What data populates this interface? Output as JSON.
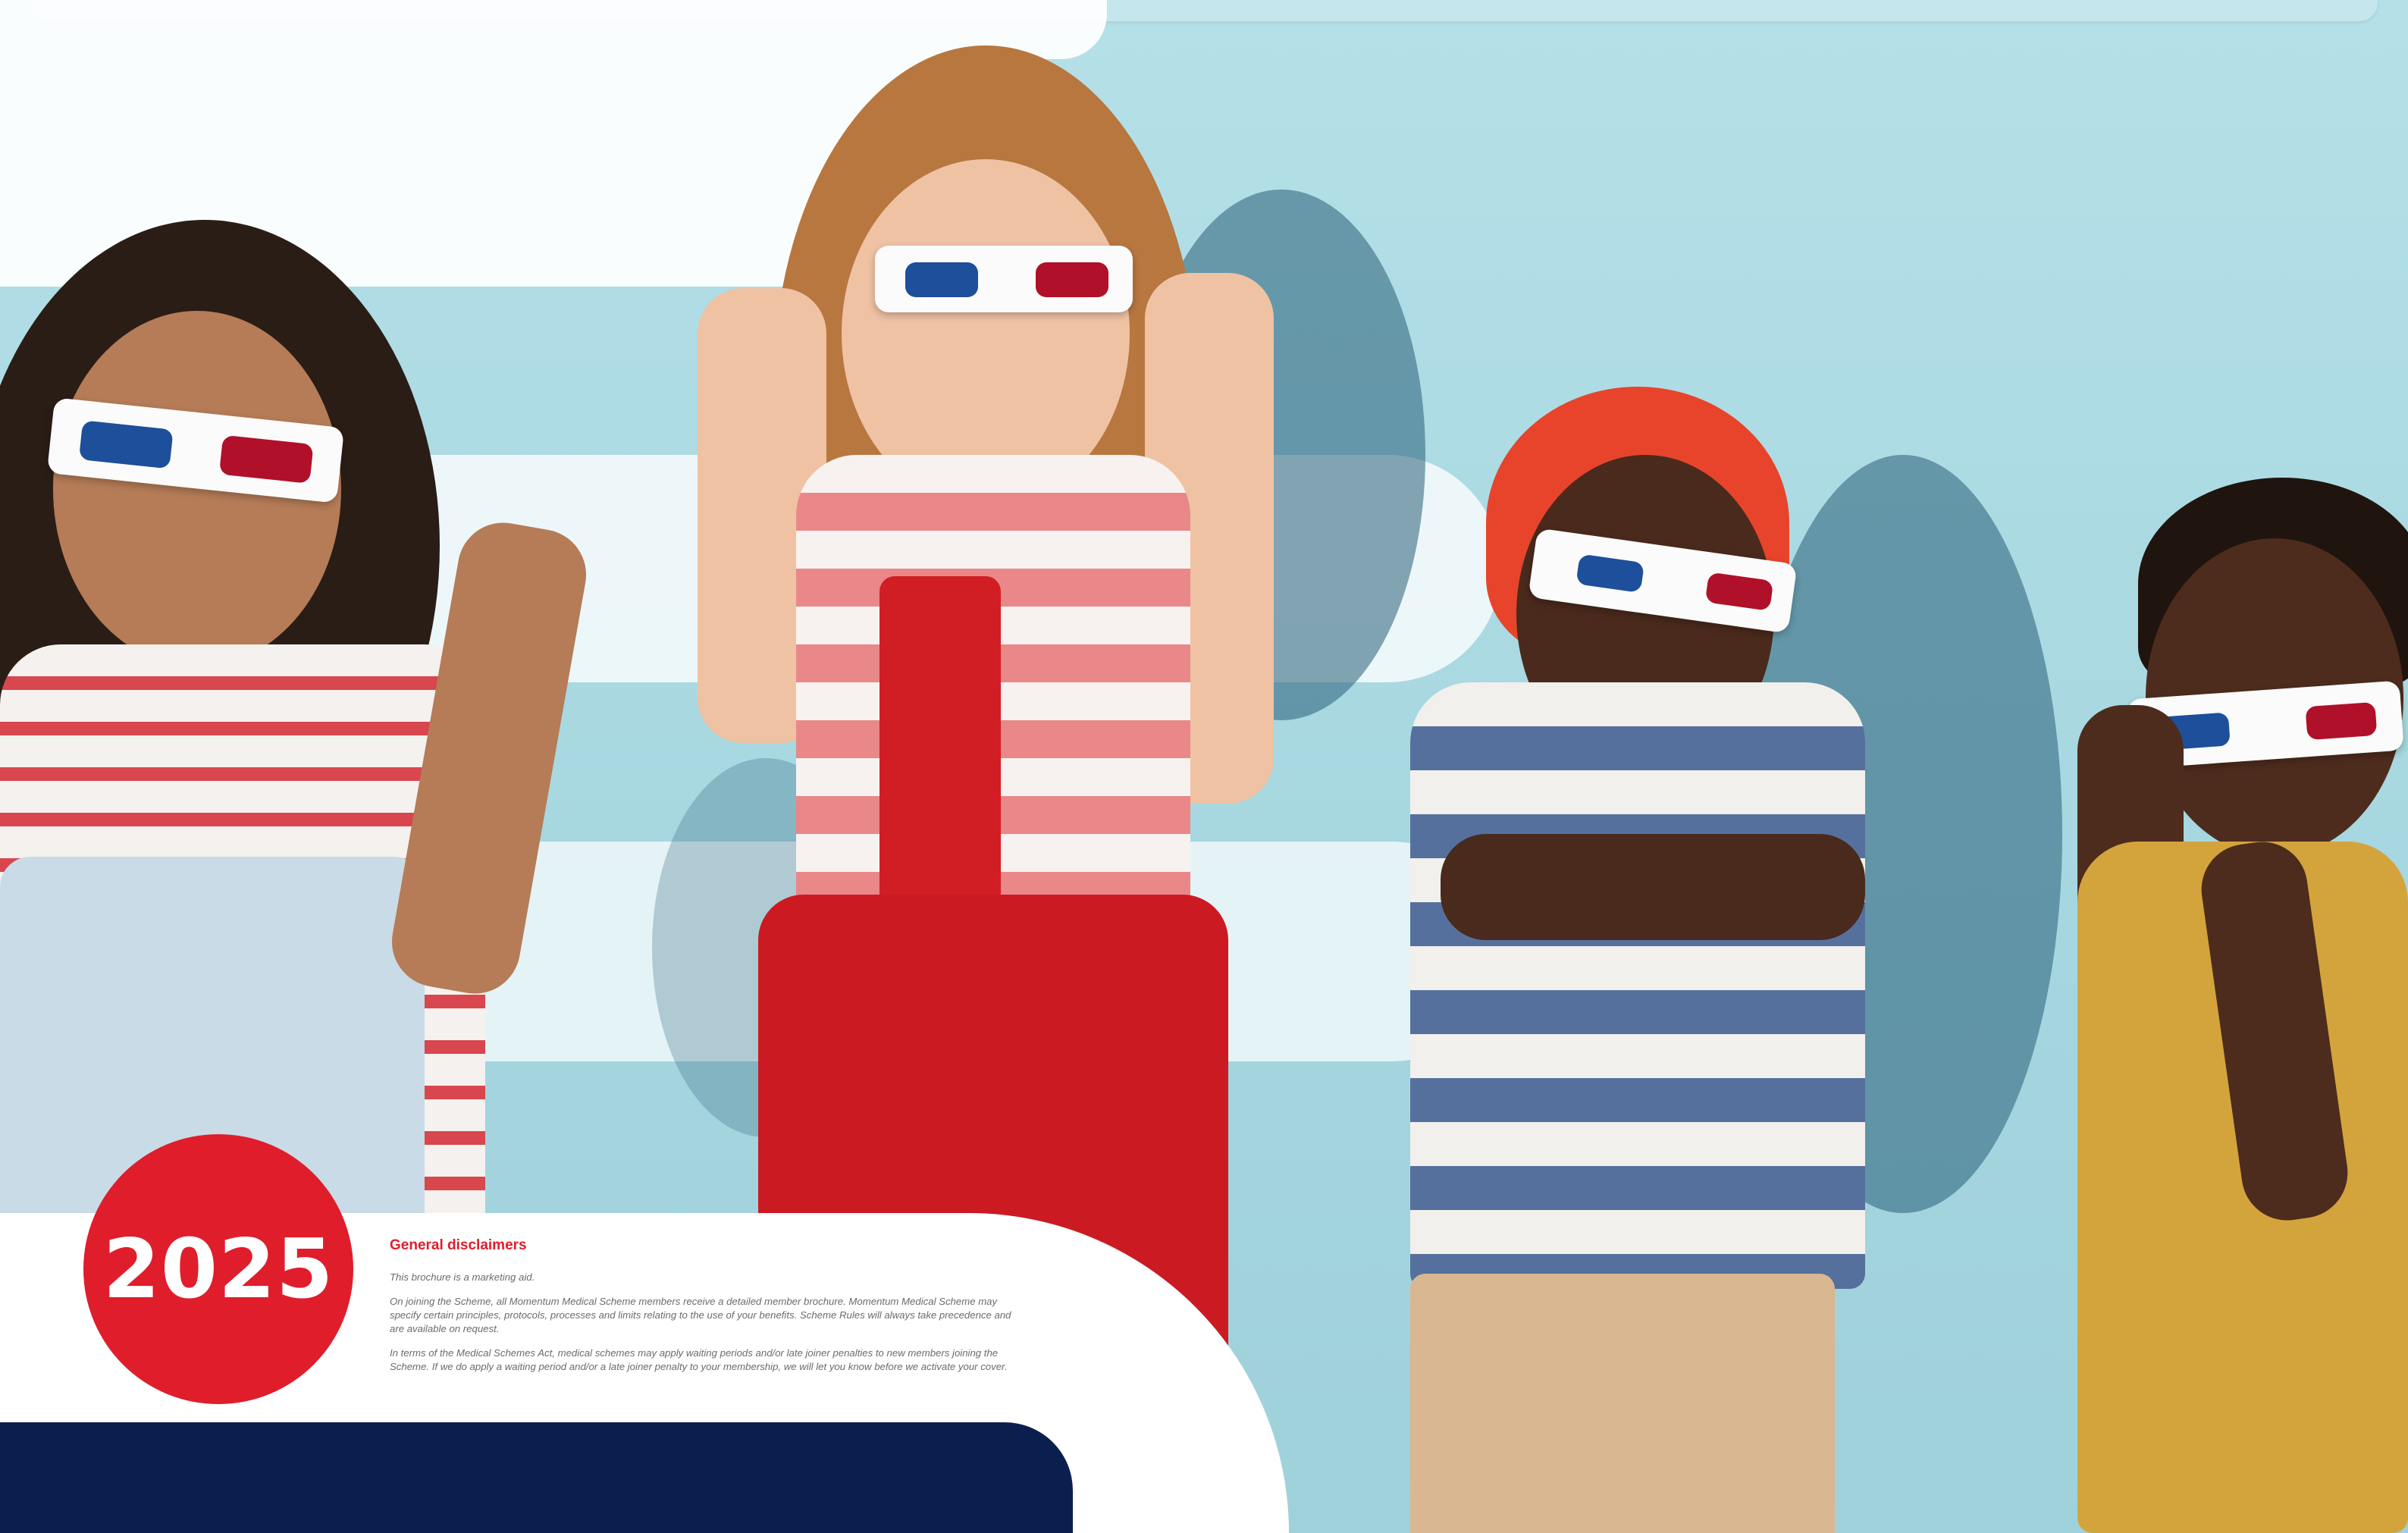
{
  "page": {
    "year_badge": "2025"
  },
  "disclaimers": {
    "title": "General disclaimers",
    "paragraphs": [
      "This brochure is a marketing aid.",
      "On joining the Scheme, all Momentum Medical Scheme members receive a detailed member brochure. Momentum Medical Scheme may specify certain principles, protocols, processes and limits relating to the use of your benefits. Scheme Rules will always take precedence and are available on request.",
      "In terms of the Medical Schemes Act, medical schemes may apply waiting periods and/or late joiner penalties to new members joining the Scheme. If we do apply a waiting period and/or a late joiner penalty to your membership, we will let you know before we activate your cover."
    ]
  },
  "colors": {
    "brand_red": "#e01d2b",
    "brand_navy": "#0b1f4e",
    "background_wall": "#a9d9e2"
  }
}
